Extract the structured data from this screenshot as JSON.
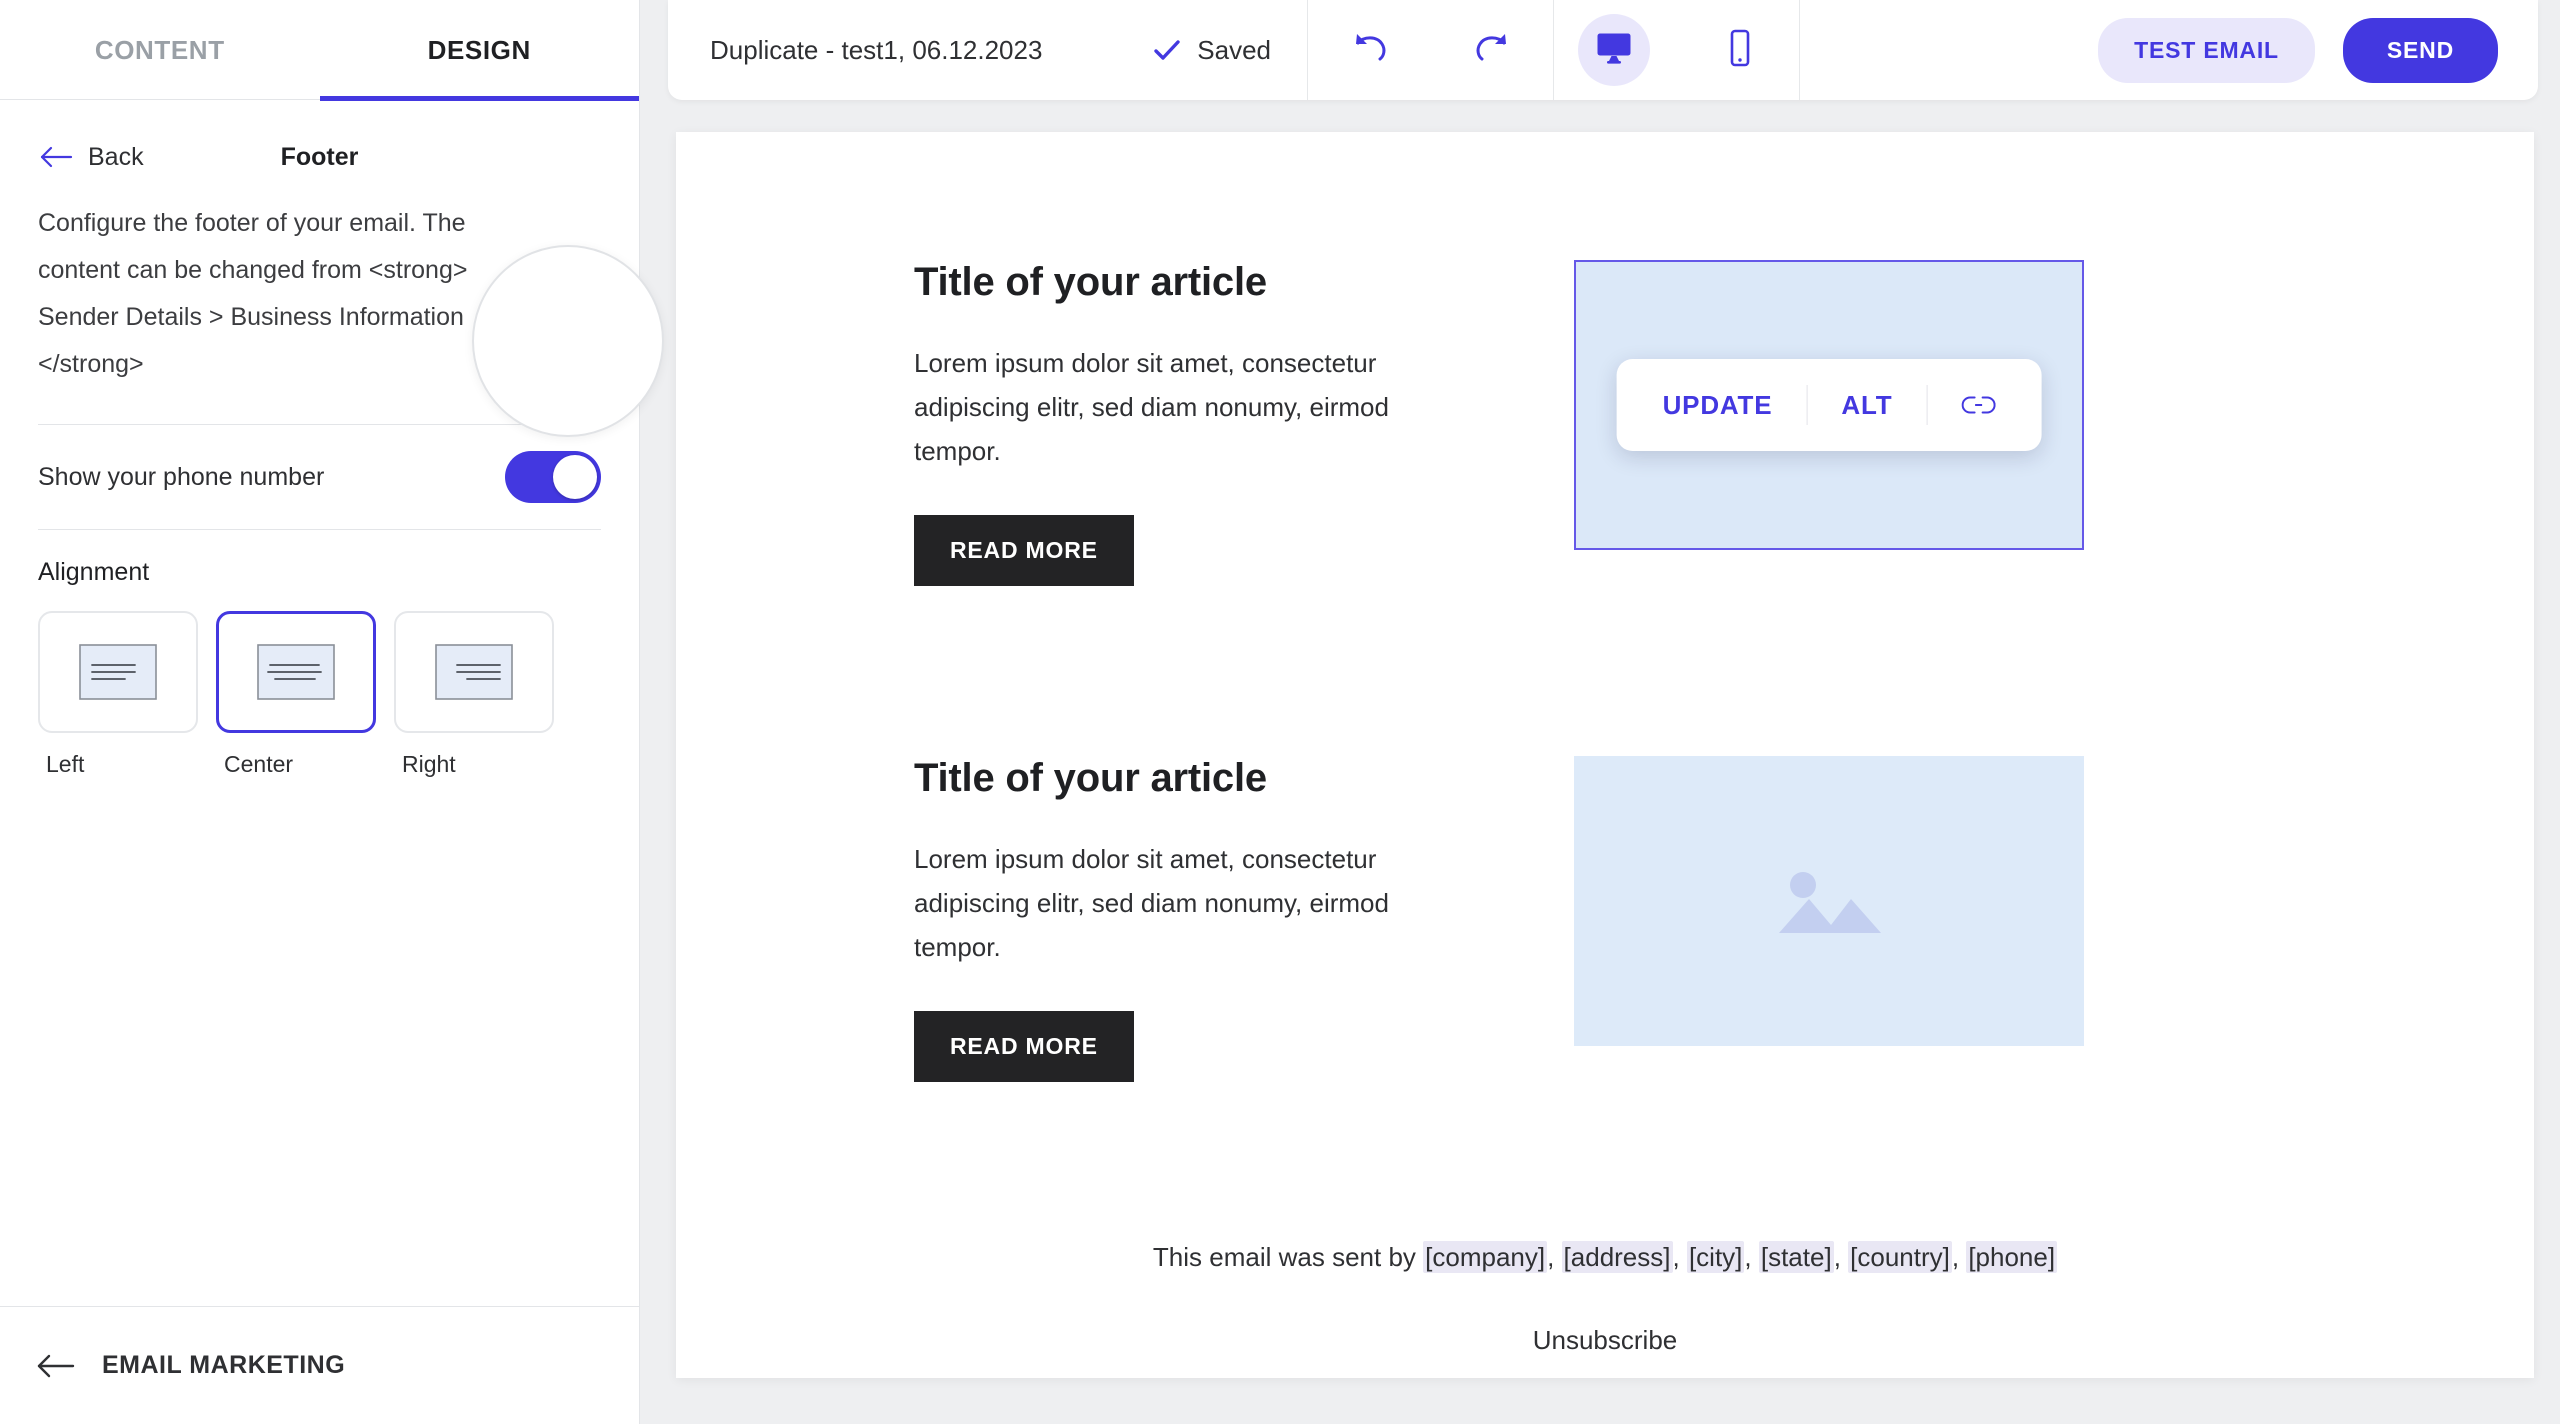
{
  "sidebar": {
    "tabs": [
      {
        "label": "CONTENT",
        "active": false
      },
      {
        "label": "DESIGN",
        "active": true
      }
    ],
    "back_label": "Back",
    "panel_title": "Footer",
    "description": "Configure the footer of your email. The content can be changed from <strong> Sender Details > Business Information </strong>",
    "toggle": {
      "label": "Show your phone number",
      "state": "on"
    },
    "alignment": {
      "title": "Alignment",
      "options": [
        {
          "label": "Left",
          "value": "left",
          "selected": false
        },
        {
          "label": "Center",
          "value": "center",
          "selected": true
        },
        {
          "label": "Right",
          "value": "right",
          "selected": false
        }
      ]
    },
    "footer_nav": {
      "label": "EMAIL MARKETING",
      "icon": "arrow-left-icon"
    }
  },
  "toolbar": {
    "campaign_title": "Duplicate - test1, 06.12.2023",
    "save_status": "Saved",
    "save_icon": "check-icon",
    "undo_icon": "undo-icon",
    "redo_icon": "redo-icon",
    "devices": [
      {
        "icon": "desktop-icon",
        "name": "desktop",
        "active": true
      },
      {
        "icon": "mobile-icon",
        "name": "mobile",
        "active": false
      }
    ],
    "test_email_label": "TEST EMAIL",
    "send_label": "SEND"
  },
  "email": {
    "articles": [
      {
        "title": "Title of your article",
        "body": "Lorem ipsum dolor sit amet, consectetur adipiscing elitr, sed diam nonumy, eirmod tempor.",
        "button_label": "READ MORE",
        "image_selected": true
      },
      {
        "title": "Title of your article",
        "body": "Lorem ipsum dolor sit amet, consectetur adipiscing elitr, sed diam nonumy, eirmod tempor.",
        "button_label": "READ MORE",
        "image_selected": false
      }
    ],
    "media_toolbar": {
      "update_label": "UPDATE",
      "alt_label": "ALT",
      "link_icon": "link-icon"
    },
    "footer": {
      "prefix": "This email was sent by ",
      "tokens": [
        "[company]",
        "[address]",
        "[city]",
        "[state]",
        "[country]",
        "[phone]"
      ],
      "unsubscribe": "Unsubscribe"
    }
  },
  "colors": {
    "accent": "#4338e0",
    "accent_soft": "#e9e7fb",
    "media_placeholder": "#ddeaf9",
    "button_dark": "#232325",
    "canvas_bg": "#eeeff1"
  }
}
